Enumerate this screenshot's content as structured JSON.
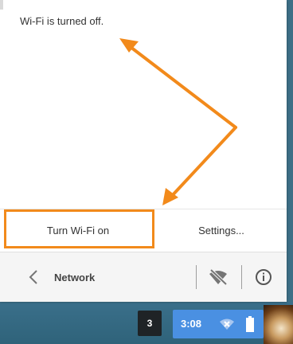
{
  "popup": {
    "message": "Wi-Fi is turned off.",
    "turn_on_label": "Turn Wi-Fi on",
    "settings_label": "Settings...",
    "footer_title": "Network"
  },
  "shelf": {
    "notification_count": "3",
    "time": "3:08"
  },
  "icons": {
    "back": "chevron-left-icon",
    "wifi_off": "wifi-off-icon",
    "info": "info-icon",
    "network_status": "wifi-disabled-icon",
    "battery": "battery-icon"
  },
  "colors": {
    "highlight": "#f28a1b",
    "status_area": "#4a90e2",
    "annotation_arrow": "#f28a1b"
  }
}
